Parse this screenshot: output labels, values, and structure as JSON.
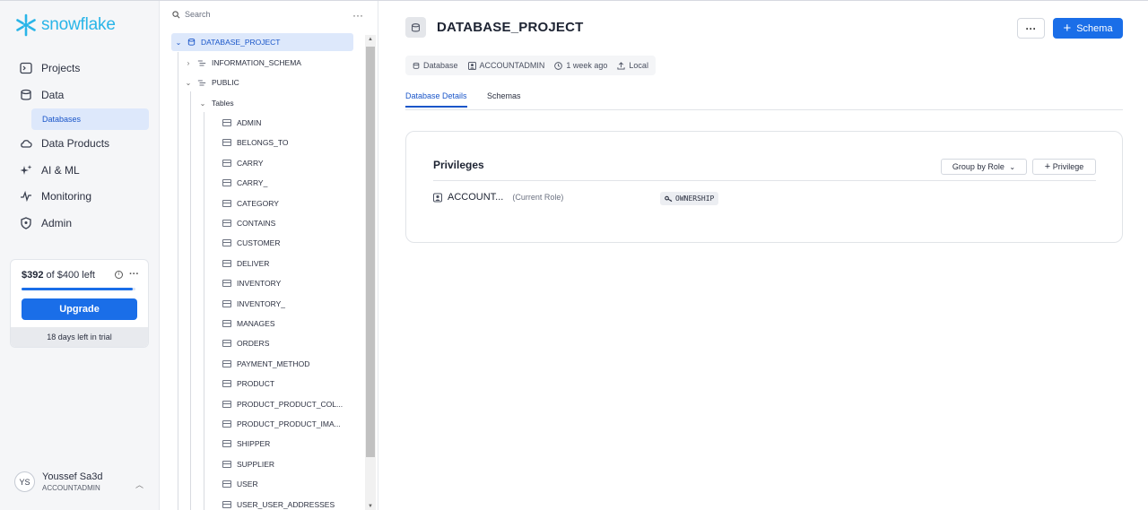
{
  "brand": {
    "name": "snowflake"
  },
  "nav": {
    "items": [
      {
        "label": "Projects",
        "icon": "terminal-icon"
      },
      {
        "label": "Data",
        "icon": "database-icon"
      },
      {
        "label": "Data Products",
        "icon": "cloud-icon"
      },
      {
        "label": "AI & ML",
        "icon": "sparkle-icon"
      },
      {
        "label": "Monitoring",
        "icon": "pulse-icon"
      },
      {
        "label": "Admin",
        "icon": "shield-icon"
      }
    ],
    "sub_item": "Databases"
  },
  "trial": {
    "amount": "$392",
    "of_text": "of $400 left",
    "remaining_fraction": 0.98,
    "upgrade_label": "Upgrade",
    "days_left": "18 days left in trial"
  },
  "user": {
    "initials": "YS",
    "name": "Youssef Sa3d",
    "role": "ACCOUNTADMIN"
  },
  "tree": {
    "search_placeholder": "Search",
    "database": "DATABASE_PROJECT",
    "schemas": [
      "INFORMATION_SCHEMA",
      "PUBLIC"
    ],
    "tables_label": "Tables",
    "tables": [
      "ADMIN",
      "BELONGS_TO",
      "CARRY",
      "CARRY_",
      "CATEGORY",
      "CONTAINS",
      "CUSTOMER",
      "DELIVER",
      "INVENTORY",
      "INVENTORY_",
      "MANAGES",
      "ORDERS",
      "PAYMENT_METHOD",
      "PRODUCT",
      "PRODUCT_PRODUCT_COL...",
      "PRODUCT_PRODUCT_IMA...",
      "SHIPPER",
      "SUPPLIER",
      "USER",
      "USER_USER_ADDRESSES"
    ]
  },
  "main": {
    "title": "DATABASE_PROJECT",
    "more_label": "···",
    "schema_button": "Schema",
    "meta": {
      "type": "Database",
      "owner": "ACCOUNTADMIN",
      "time": "1 week ago",
      "source": "Local"
    },
    "tabs": [
      "Database Details",
      "Schemas"
    ],
    "privileges": {
      "title": "Privileges",
      "group_label": "Group by Role",
      "add_label": "Privilege",
      "role": "ACCOUNT...",
      "role_note": "(Current Role)",
      "grant": "OWNERSHIP"
    }
  },
  "colors": {
    "accent": "#1a6ee8",
    "brand": "#29b5e8",
    "selected_bg": "#dde8fb"
  }
}
